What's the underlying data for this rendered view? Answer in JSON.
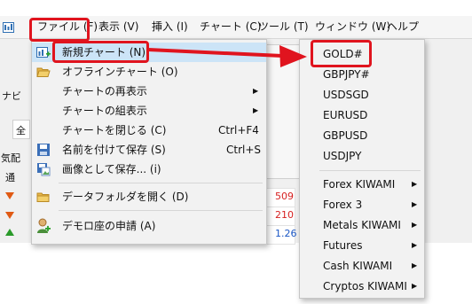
{
  "menubar": {
    "items": [
      {
        "label": "ファイル (F)"
      },
      {
        "label": "表示 (V)"
      },
      {
        "label": "挿入 (I)"
      },
      {
        "label": "チャート (C)"
      },
      {
        "label": "ツール (T)"
      },
      {
        "label": "ウィンドウ (W)"
      },
      {
        "label": "ヘルプ"
      }
    ]
  },
  "file_menu": {
    "items": [
      {
        "label": "新規チャート (N)",
        "icon": "new-chart-icon",
        "submenu": false
      },
      {
        "label": "オフラインチャート (O)",
        "icon": "folder-open-icon",
        "submenu": false
      },
      {
        "label": "チャートの再表示",
        "submenu": true
      },
      {
        "label": "チャートの組表示",
        "submenu": true
      },
      {
        "label": "チャートを閉じる (C)",
        "shortcut": "Ctrl+F4"
      },
      {
        "label": "名前を付けて保存 (S)",
        "icon": "save-icon",
        "shortcut": "Ctrl+S"
      },
      {
        "label": "画像として保存... (i)",
        "icon": "save-image-icon"
      },
      {
        "label": "データフォルダを開く (D)",
        "icon": "folder-icon"
      },
      {
        "label": "デモロ座の申請 (A)",
        "icon": "demo-account-icon"
      }
    ]
  },
  "symbol_menu": {
    "symbols": [
      "GOLD#",
      "GBPJPY#",
      "USDSGD",
      "EURUSD",
      "GBPUSD",
      "USDJPY"
    ],
    "groups": [
      "Forex KIWAMI",
      "Forex 3",
      "Metals KIWAMI",
      "Futures",
      "Cash KIWAMI",
      "Cryptos KIWAMI"
    ]
  },
  "background": {
    "left_fragments": [
      "ナビ",
      "全",
      "気配",
      "通"
    ],
    "quotes": [
      "509",
      "210",
      "1.26"
    ],
    "quote_colors": [
      "#d62020",
      "#d62020",
      "#1a56c4"
    ]
  },
  "colors": {
    "highlight": "#e0141e",
    "menu_bg": "#f2f2f2",
    "selected_bg": "#cce4f7"
  }
}
